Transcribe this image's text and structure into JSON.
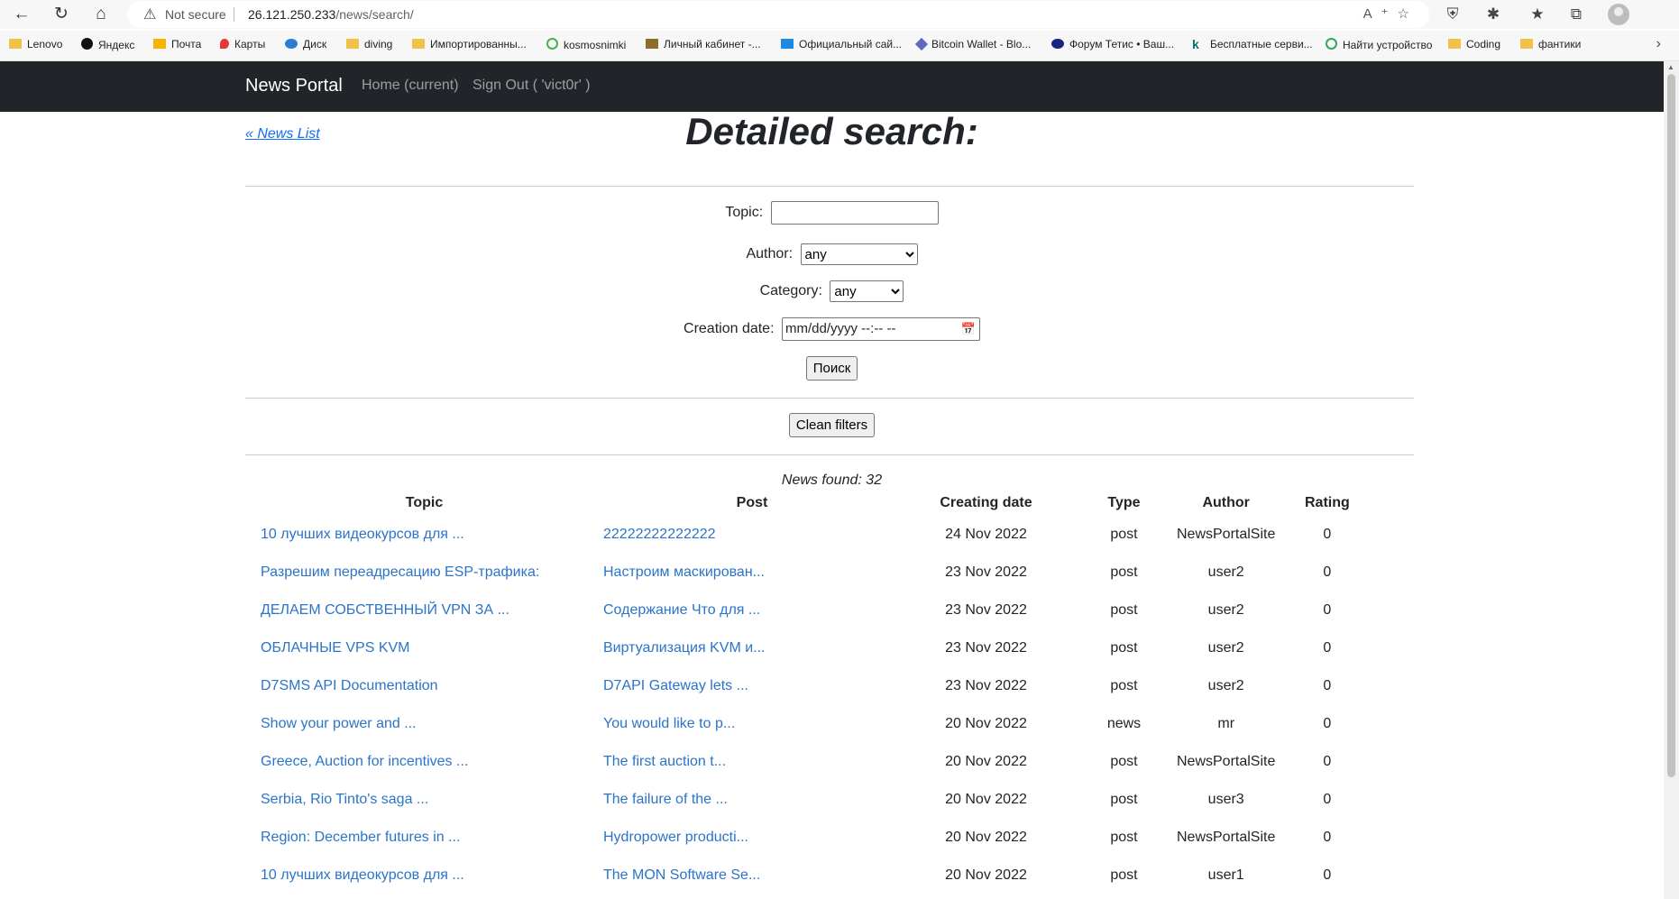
{
  "browser": {
    "security_label": "Not secure",
    "url_host": "26.121.250.233",
    "url_path": "/news/search/",
    "bookmarks": [
      "Lenovo",
      "Яндекс",
      "Почта",
      "Карты",
      "Диск",
      "diving",
      "Импортированны...",
      "kosmosnimki",
      "Личный кабинет -...",
      "Официальный сай...",
      "Bitcoin Wallet - Blo...",
      "Форум Тетис • Ваш...",
      "Бесплатные серви...",
      "Найти устройство",
      "Coding",
      "фантики"
    ]
  },
  "site_nav": {
    "brand": "News Portal",
    "home": "Home (current)",
    "signout": "Sign Out ( 'vict0r' )"
  },
  "page": {
    "back_link": "« News List",
    "title": "Detailed search:"
  },
  "form": {
    "topic_label": "Topic:",
    "topic_value": "",
    "author_label": "Author:",
    "author_value": "any",
    "category_label": "Category:",
    "category_value": "any",
    "date_label": "Creation date:",
    "date_placeholder": "mm/dd/yyyy --:-- --",
    "search_button": "Поиск",
    "clean_button": "Clean filters"
  },
  "results": {
    "found_text": "News found: 32",
    "columns": [
      "Topic",
      "Post",
      "Creating date",
      "Type",
      "Author",
      "Rating"
    ],
    "rows": [
      [
        "10 лучших видеокурсов для ...",
        "22222222222222",
        "24 Nov 2022",
        "post",
        "NewsPortalSite",
        "0"
      ],
      [
        "Разрешим переадресацию ESP-трафика:",
        "Настроим маскирован...",
        "23 Nov 2022",
        "post",
        "user2",
        "0"
      ],
      [
        "ДЕЛАЕМ СОБСТВЕННЫЙ VPN ЗА ...",
        "Содержание Что для ...",
        "23 Nov 2022",
        "post",
        "user2",
        "0"
      ],
      [
        "ОБЛАЧНЫЕ VPS KVM",
        "Виртуализация KVM и...",
        "23 Nov 2022",
        "post",
        "user2",
        "0"
      ],
      [
        "D7SMS API Documentation",
        "D7API Gateway lets ...",
        "23 Nov 2022",
        "post",
        "user2",
        "0"
      ],
      [
        "Show your power and ...",
        "You would like to p...",
        "20 Nov 2022",
        "news",
        "mr",
        "0"
      ],
      [
        "Greece, Auction for incentives ...",
        "The first auction t...",
        "20 Nov 2022",
        "post",
        "NewsPortalSite",
        "0"
      ],
      [
        "Serbia, Rio Tinto's saga ...",
        "The failure of the ...",
        "20 Nov 2022",
        "post",
        "user3",
        "0"
      ],
      [
        "Region: December futures in ...",
        "Hydropower producti...",
        "20 Nov 2022",
        "post",
        "NewsPortalSite",
        "0"
      ],
      [
        "10 лучших видеокурсов для ...",
        "The MON Software Se...",
        "20 Nov 2022",
        "post",
        "user1",
        "0"
      ]
    ]
  }
}
